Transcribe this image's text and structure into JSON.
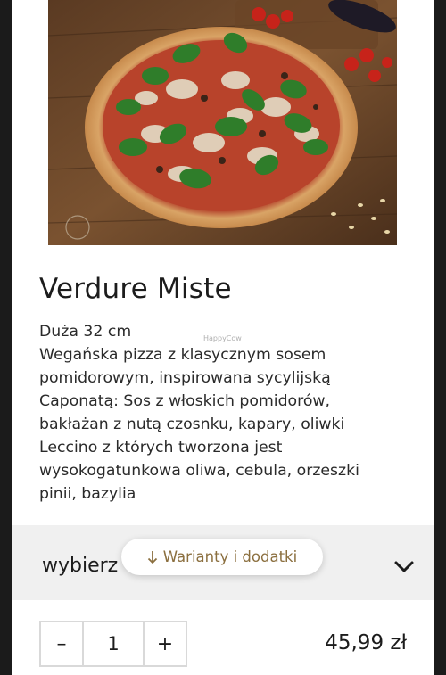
{
  "product": {
    "name": "Verdure Miste",
    "size": "Duża 32 cm",
    "description_lines": [
      "Wegańska pizza z klasycznym sosem",
      "pomidorowym, inspirowana sycylijską",
      "Caponatą: Sos z włoskich pomidorów,",
      "bakłażan z nutą czosnku, kapary, oliwki",
      "Leccino z których tworzona jest",
      "wysokogatunkowa oliwa, cebula, orzeszki",
      "pinii, bazylia"
    ],
    "watermark": "HappyCow"
  },
  "variant": {
    "select_label": "wybierz",
    "pill_label": "Warianty i dodatki",
    "pill_icon": "arrow-down-icon",
    "chevron_icon": "chevron-down-icon"
  },
  "order": {
    "decrement": "–",
    "quantity": "1",
    "increment": "+",
    "price": "45,99 zł"
  },
  "colors": {
    "accent_text": "#8b6f3f",
    "variant_bg": "#f0f0f0",
    "page_bg": "#1b1b1b"
  }
}
